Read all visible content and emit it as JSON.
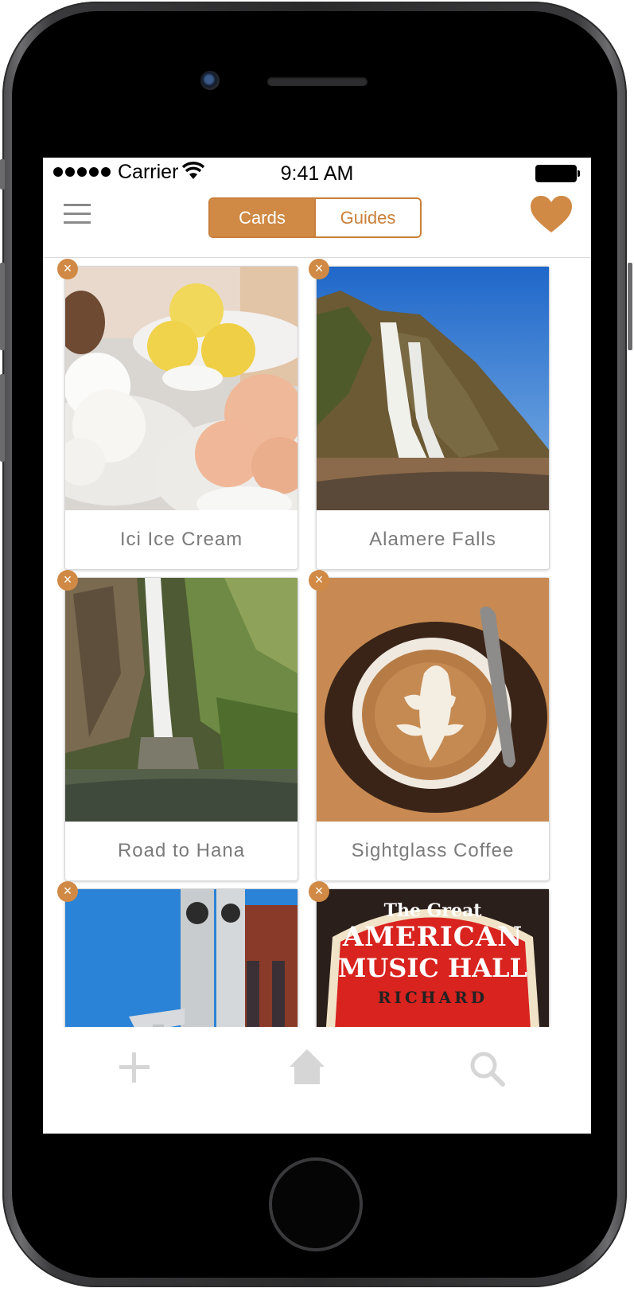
{
  "status_bar": {
    "carrier": "Carrier",
    "time": "9:41 AM"
  },
  "header": {
    "segments": [
      {
        "label": "Cards",
        "active": true
      },
      {
        "label": "Guides",
        "active": false
      }
    ],
    "accent_color": "#d08a45",
    "menu_icon": "hamburger-menu-icon",
    "favorite_icon": "heart-icon"
  },
  "cards": [
    {
      "title": "Ici Ice Cream",
      "image": "ice-cream-photo"
    },
    {
      "title": "Alamere Falls",
      "image": "waterfall-cliff-photo"
    },
    {
      "title": "Road to Hana",
      "image": "jungle-waterfall-photo"
    },
    {
      "title": "Sightglass Coffee",
      "image": "latte-art-photo"
    },
    {
      "title": "",
      "image": "brewery-silos-photo"
    },
    {
      "title": "",
      "image": "music-hall-marquee-photo",
      "sign_text": [
        "The Great",
        "AMERICAN",
        "MUSIC HALL",
        "RICHARD"
      ]
    }
  ],
  "remove_badge_symbol": "×",
  "tab_bar": {
    "items": [
      "add-icon",
      "home-icon",
      "search-icon"
    ]
  }
}
